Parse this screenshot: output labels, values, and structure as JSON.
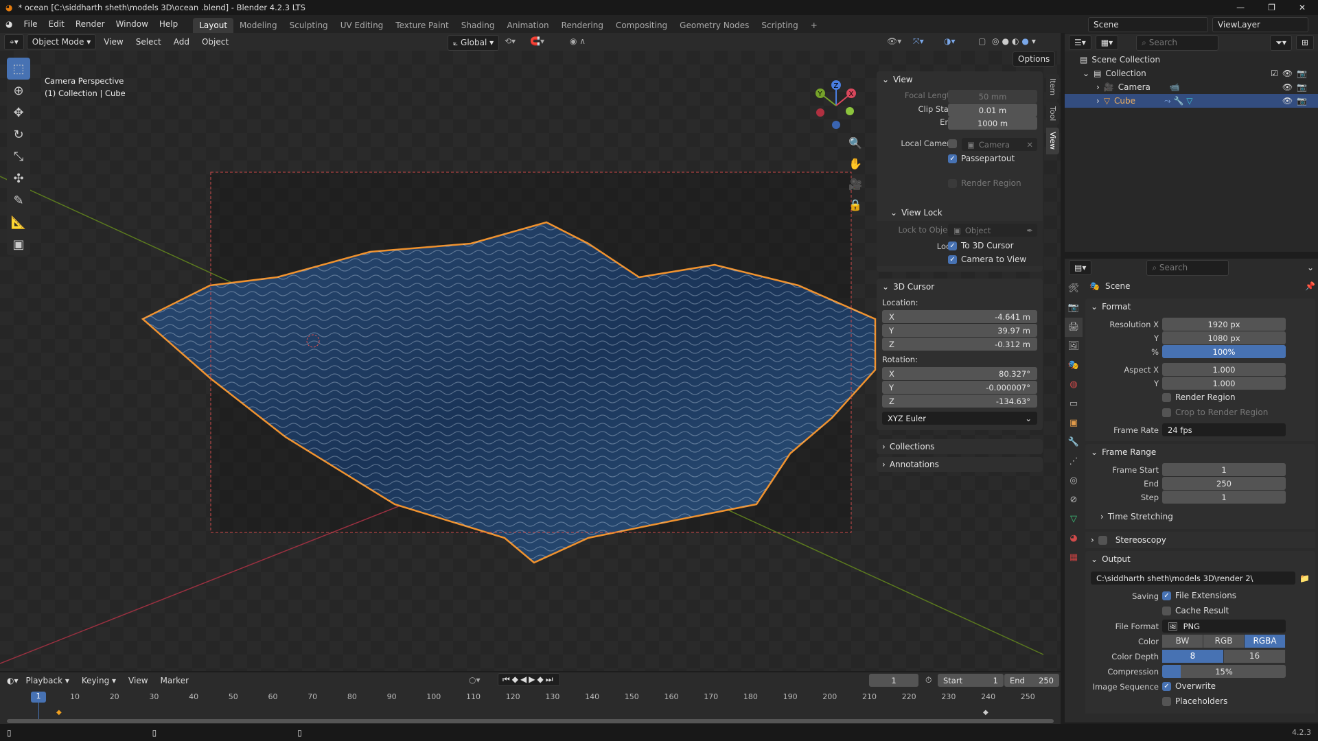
{
  "window": {
    "title": "* ocean  [C:\\siddharth sheth\\models 3D\\ocean .blend] - Blender 4.2.3 LTS",
    "minimize": "—",
    "maximize": "❐",
    "close": "✕"
  },
  "menus": [
    "File",
    "Edit",
    "Render",
    "Window",
    "Help"
  ],
  "workspaces": [
    "Layout",
    "Modeling",
    "Sculpting",
    "UV Editing",
    "Texture Paint",
    "Shading",
    "Animation",
    "Rendering",
    "Compositing",
    "Geometry Nodes",
    "Scripting"
  ],
  "workspace_add": "+",
  "scene_selector": {
    "scene": "Scene",
    "view_layer": "ViewLayer"
  },
  "viewport_header": {
    "mode": "Object Mode",
    "menus": [
      "View",
      "Select",
      "Add",
      "Object"
    ],
    "orientation": "Global",
    "options": "Options"
  },
  "viewport": {
    "view_name": "Camera Perspective",
    "context": "(1) Collection | Cube",
    "gizmo": {
      "x": "X",
      "y": "Y",
      "z": "Z"
    }
  },
  "npanel": {
    "tabs": [
      "Item",
      "Tool",
      "View"
    ],
    "view": {
      "title": "View",
      "focal_length_label": "Focal Length",
      "focal_length": "50 mm",
      "clip_start_label": "Clip Start",
      "clip_start": "0.01 m",
      "end_label": "End",
      "clip_end": "1000 m",
      "local_camera_label": "Local Camera",
      "local_camera": "Camera",
      "passepartout": "Passepartout",
      "render_region": "Render Region"
    },
    "view_lock": {
      "title": "View Lock",
      "lock_to_object_label": "Lock to Object",
      "lock_to_object_placeholder": "Object",
      "lock_label": "Lock",
      "to_3d_cursor": "To 3D Cursor",
      "camera_to_view": "Camera to View"
    },
    "cursor": {
      "title": "3D Cursor",
      "location_label": "Location:",
      "location": [
        {
          "axis": "X",
          "value": "-4.641 m"
        },
        {
          "axis": "Y",
          "value": "39.97 m"
        },
        {
          "axis": "Z",
          "value": "-0.312 m"
        }
      ],
      "rotation_label": "Rotation:",
      "rotation": [
        {
          "axis": "X",
          "value": "80.327°"
        },
        {
          "axis": "Y",
          "value": "-0.000007°"
        },
        {
          "axis": "Z",
          "value": "-134.63°"
        }
      ],
      "rotation_mode": "XYZ Euler"
    },
    "collections": "Collections",
    "annotations": "Annotations"
  },
  "outliner": {
    "search_placeholder": "Search",
    "items": [
      {
        "label": "Scene Collection"
      },
      {
        "label": "Collection"
      },
      {
        "label": "Camera"
      },
      {
        "label": "Cube"
      }
    ]
  },
  "properties": {
    "search_placeholder": "Search",
    "context": "Scene",
    "format": {
      "title": "Format",
      "res_x_label": "Resolution X",
      "res_x": "1920 px",
      "res_y_label": "Y",
      "res_y": "1080 px",
      "pct_label": "%",
      "pct": "100%",
      "aspect_x_label": "Aspect X",
      "aspect_x": "1.000",
      "aspect_y_label": "Y",
      "aspect_y": "1.000",
      "render_region": "Render Region",
      "crop": "Crop to Render Region",
      "frame_rate_label": "Frame Rate",
      "frame_rate": "24 fps"
    },
    "frame_range": {
      "title": "Frame Range",
      "start_label": "Frame Start",
      "start": "1",
      "end_label": "End",
      "end": "250",
      "step_label": "Step",
      "step": "1",
      "time_stretching": "Time Stretching"
    },
    "stereoscopy": "Stereoscopy",
    "output": {
      "title": "Output",
      "path": "C:\\siddharth sheth\\models 3D\\render 2\\",
      "saving_label": "Saving",
      "file_extensions": "File Extensions",
      "cache_result": "Cache Result",
      "file_format_label": "File Format",
      "file_format": "PNG",
      "color_label": "Color",
      "color_options": [
        "BW",
        "RGB",
        "RGBA"
      ],
      "color_selected": "RGBA",
      "depth_label": "Color Depth",
      "depth_options": [
        "8",
        "16"
      ],
      "depth_selected": "8",
      "compression_label": "Compression",
      "compression": "15%",
      "compression_value": 15,
      "image_seq_label": "Image Sequence",
      "overwrite": "Overwrite",
      "placeholders": "Placeholders"
    }
  },
  "timeline": {
    "menus": [
      "Playback",
      "Keying",
      "View",
      "Marker"
    ],
    "current_frame": "1",
    "start_label": "Start",
    "start": "1",
    "end_label": "End",
    "end": "250",
    "ticks": [
      "10",
      "20",
      "30",
      "40",
      "50",
      "60",
      "70",
      "80",
      "90",
      "100",
      "110",
      "120",
      "130",
      "140",
      "150",
      "160",
      "170",
      "180",
      "190",
      "200",
      "210",
      "220",
      "230",
      "240",
      "250"
    ],
    "playhead": "1"
  },
  "status": {
    "version": "4.2.3"
  }
}
